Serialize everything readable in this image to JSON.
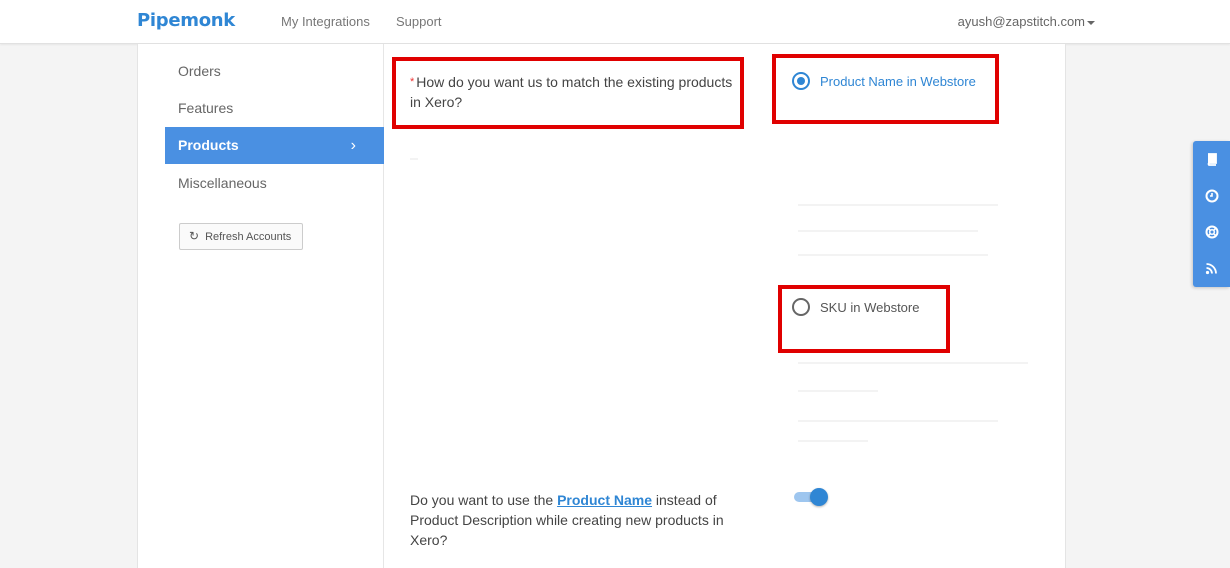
{
  "header": {
    "brand": "Pipemonk",
    "nav": [
      "My Integrations",
      "Support"
    ],
    "user_email": "ayush@zapstitch.com"
  },
  "sidebar": {
    "items": [
      {
        "label": "Orders"
      },
      {
        "label": "Features"
      },
      {
        "label": "Products",
        "active": true
      },
      {
        "label": "Miscellaneous"
      }
    ],
    "refresh_label": "Refresh Accounts"
  },
  "content": {
    "match_question": {
      "required_marker": "*",
      "text": "How do you want us to match the existing products in Xero?"
    },
    "options": [
      {
        "label": "Product Name in Webstore",
        "selected": true
      },
      {
        "label": "SKU in Webstore",
        "selected": false
      }
    ],
    "product_name_question": {
      "prefix": "Do you want to use the ",
      "link": "Product Name",
      "suffix": " instead of Product Description while creating new products in Xero?"
    },
    "toggle_on": true
  },
  "colors": {
    "brand": "#2f86d4",
    "active_sidebar": "#4a90e2",
    "highlight": "#e00000"
  },
  "float_toolbar": {
    "icons": [
      "book-icon",
      "clock-icon",
      "lifebuoy-icon",
      "rss-icon"
    ]
  }
}
